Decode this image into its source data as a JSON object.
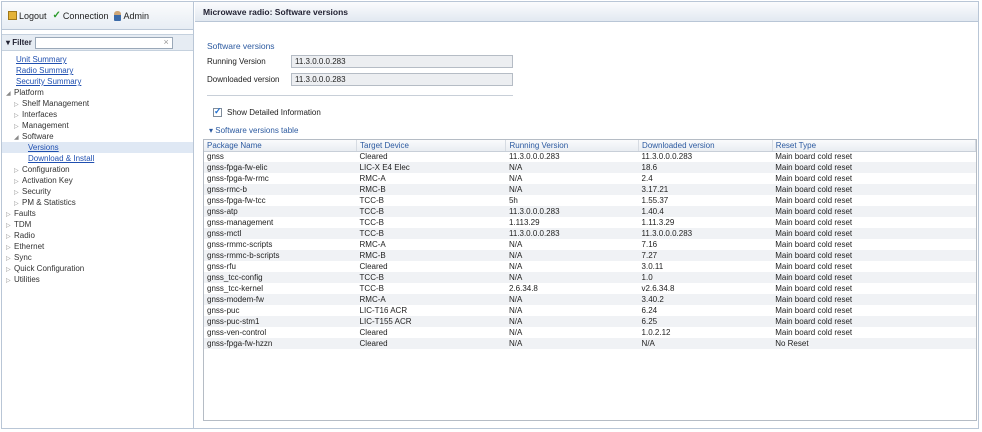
{
  "toolbar": {
    "logout": "Logout",
    "connection": "Connection",
    "admin": "Admin"
  },
  "filter": {
    "label": "Filter",
    "clear": "×"
  },
  "tree": [
    {
      "label": "Unit Summary",
      "link": true
    },
    {
      "label": "Radio Summary",
      "link": true
    },
    {
      "label": "Security Summary",
      "link": true
    },
    {
      "label": "Platform",
      "link": false,
      "arrow": "◢"
    },
    {
      "label": "Shelf Management",
      "link": false,
      "arrow": "▷"
    },
    {
      "label": "Interfaces",
      "link": false,
      "arrow": "▷"
    },
    {
      "label": "Management",
      "link": false,
      "arrow": "▷"
    },
    {
      "label": "Software",
      "link": false,
      "arrow": "◢"
    },
    {
      "label": "Versions",
      "link": true,
      "selected": true
    },
    {
      "label": "Download & Install",
      "link": true
    },
    {
      "label": "Configuration",
      "link": false,
      "arrow": "▷"
    },
    {
      "label": "Activation Key",
      "link": false,
      "arrow": "▷"
    },
    {
      "label": "Security",
      "link": false,
      "arrow": "▷"
    },
    {
      "label": "PM & Statistics",
      "link": false,
      "arrow": "▷"
    },
    {
      "label": "Faults",
      "link": false,
      "arrow": "▷"
    },
    {
      "label": "TDM",
      "link": false,
      "arrow": "▷"
    },
    {
      "label": "Radio",
      "link": false,
      "arrow": "▷"
    },
    {
      "label": "Ethernet",
      "link": false,
      "arrow": "▷"
    },
    {
      "label": "Sync",
      "link": false,
      "arrow": "▷"
    },
    {
      "label": "Quick Configuration",
      "link": false,
      "arrow": "▷"
    },
    {
      "label": "Utilities",
      "link": false,
      "arrow": "▷"
    }
  ],
  "main": {
    "title": "Microwave radio: Software versions",
    "section_title": "Software versions",
    "running_label": "Running Version",
    "running_value": "11.3.0.0.0.283",
    "downloaded_label": "Downloaded version",
    "downloaded_value": "11.3.0.0.0.283",
    "checkbox_label": "Show Detailed Information",
    "table_title": "Software versions table"
  },
  "table": {
    "headers": [
      "Package Name",
      "Target Device",
      "Running Version",
      "Downloaded version",
      "Reset Type"
    ],
    "rows": [
      [
        "gnss",
        "Cleared",
        "11.3.0.0.0.283",
        "11.3.0.0.0.283",
        "Main board cold reset"
      ],
      [
        "gnss-fpga-fw-elic",
        "LIC-X E4 Elec",
        "N/A",
        "18.6",
        "Main board cold reset"
      ],
      [
        "gnss-fpga-fw-rmc",
        "RMC-A",
        "N/A",
        "2.4",
        "Main board cold reset"
      ],
      [
        "gnss-rmc-b",
        "RMC-B",
        "N/A",
        "3.17.21",
        "Main board cold reset"
      ],
      [
        "gnss-fpga-fw-tcc",
        "TCC-B",
        "5h",
        "1.55.37",
        "Main board cold reset"
      ],
      [
        "gnss-atp",
        "TCC-B",
        "11.3.0.0.0.283",
        "1.40.4",
        "Main board cold reset"
      ],
      [
        "gnss-management",
        "TCC-B",
        "1.113.29",
        "1.11.3.29",
        "Main board cold reset"
      ],
      [
        "gnss-mctl",
        "TCC-B",
        "11.3.0.0.0.283",
        "11.3.0.0.0.283",
        "Main board cold reset"
      ],
      [
        "gnss-rmmc-scripts",
        "RMC-A",
        "N/A",
        "7.16",
        "Main board cold reset"
      ],
      [
        "gnss-rmmc-b-scripts",
        "RMC-B",
        "N/A",
        "7.27",
        "Main board cold reset"
      ],
      [
        "gnss-rfu",
        "Cleared",
        "N/A",
        "3.0.11",
        "Main board cold reset"
      ],
      [
        "gnss_tcc-config",
        "TCC-B",
        "N/A",
        "1.0",
        "Main board cold reset"
      ],
      [
        "gnss_tcc-kernel",
        "TCC-B",
        "2.6.34.8",
        "v2.6.34.8",
        "Main board cold reset"
      ],
      [
        "gnss-modem-fw",
        "RMC-A",
        "N/A",
        "3.40.2",
        "Main board cold reset"
      ],
      [
        "gnss-puc",
        "LIC-T16 ACR",
        "N/A",
        "6.24",
        "Main board cold reset"
      ],
      [
        "gnss-puc-stm1",
        "LIC-T155 ACR",
        "N/A",
        "6.25",
        "Main board cold reset"
      ],
      [
        "gnss-ven-control",
        "Cleared",
        "N/A",
        "1.0.2.12",
        "Main board cold reset"
      ],
      [
        "gnss-fpga-fw-hzzn",
        "Cleared",
        "N/A",
        "N/A",
        "No Reset"
      ]
    ]
  }
}
